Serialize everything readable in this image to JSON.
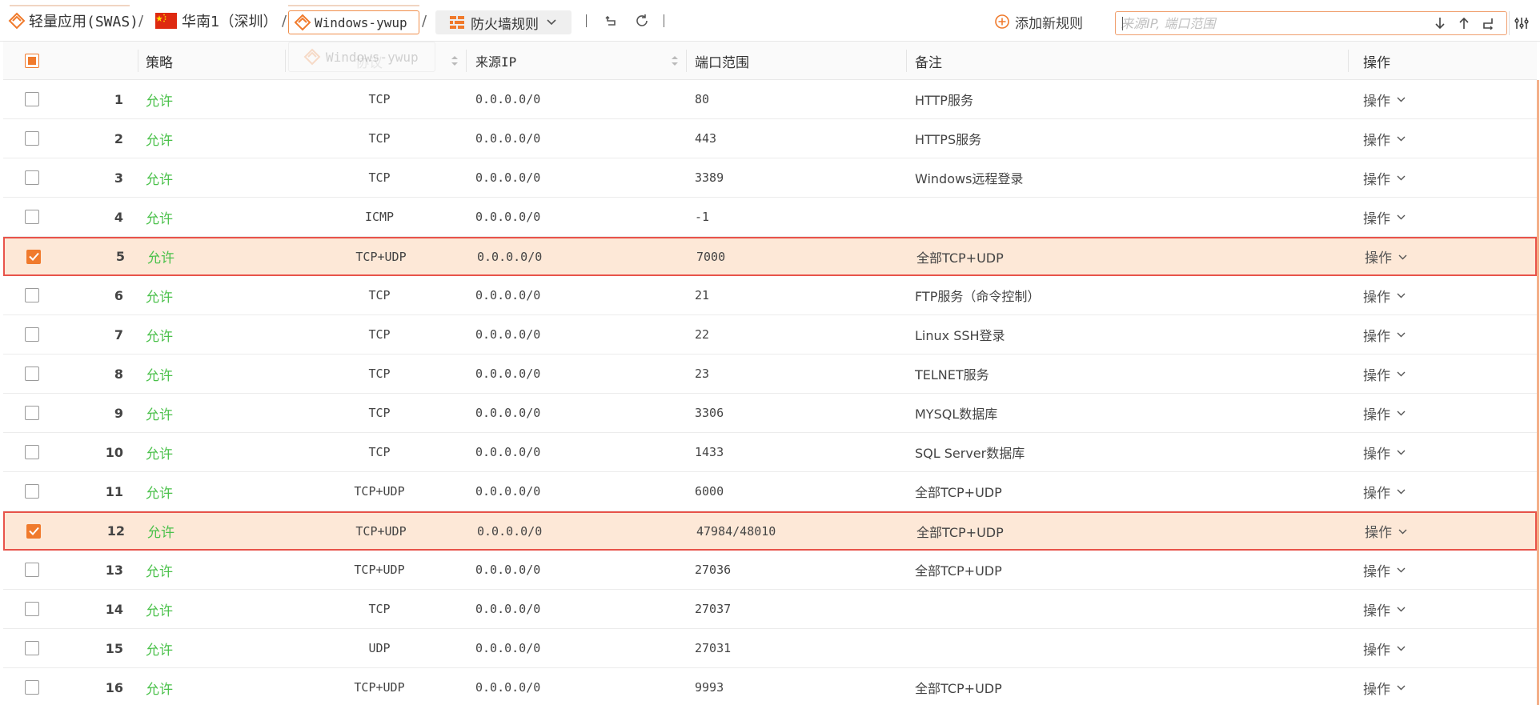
{
  "breadcrumb": {
    "swas_label": "轻量应用(SWAS)",
    "sep1": "/",
    "region_label": "华南1（深圳）",
    "sep2": "/",
    "instance_label": "Windows-ywup",
    "sep3": "/",
    "section_label": "防火墙规则"
  },
  "toolbar": {
    "add_rule_label": "添加新规则",
    "search_placeholder": "来源IP, 端口范围"
  },
  "drag_ghost_label": "Windows-ywup",
  "colors": {
    "accent": "#f07a2c",
    "allow": "#4bc14b",
    "selected_row_bg": "#fde8d7",
    "selected_row_border": "#e8534a"
  },
  "table": {
    "headers": {
      "policy": "策略",
      "protocol": "协议",
      "source_ip": "来源IP",
      "port_range": "端口范围",
      "remark": "备注",
      "action": "操作"
    },
    "rows": [
      {
        "index": "1",
        "policy": "允许",
        "protocol": "TCP",
        "source_ip": "0.0.0.0/0",
        "port_range": "80",
        "remark": "HTTP服务",
        "action": "操作",
        "selected": false
      },
      {
        "index": "2",
        "policy": "允许",
        "protocol": "TCP",
        "source_ip": "0.0.0.0/0",
        "port_range": "443",
        "remark": "HTTPS服务",
        "action": "操作",
        "selected": false
      },
      {
        "index": "3",
        "policy": "允许",
        "protocol": "TCP",
        "source_ip": "0.0.0.0/0",
        "port_range": "3389",
        "remark": "Windows远程登录",
        "action": "操作",
        "selected": false
      },
      {
        "index": "4",
        "policy": "允许",
        "protocol": "ICMP",
        "source_ip": "0.0.0.0/0",
        "port_range": "-1",
        "remark": "",
        "action": "操作",
        "selected": false
      },
      {
        "index": "5",
        "policy": "允许",
        "protocol": "TCP+UDP",
        "source_ip": "0.0.0.0/0",
        "port_range": "7000",
        "remark": "全部TCP+UDP",
        "action": "操作",
        "selected": true
      },
      {
        "index": "6",
        "policy": "允许",
        "protocol": "TCP",
        "source_ip": "0.0.0.0/0",
        "port_range": "21",
        "remark": "FTP服务（命令控制）",
        "action": "操作",
        "selected": false
      },
      {
        "index": "7",
        "policy": "允许",
        "protocol": "TCP",
        "source_ip": "0.0.0.0/0",
        "port_range": "22",
        "remark": "Linux SSH登录",
        "action": "操作",
        "selected": false
      },
      {
        "index": "8",
        "policy": "允许",
        "protocol": "TCP",
        "source_ip": "0.0.0.0/0",
        "port_range": "23",
        "remark": "TELNET服务",
        "action": "操作",
        "selected": false
      },
      {
        "index": "9",
        "policy": "允许",
        "protocol": "TCP",
        "source_ip": "0.0.0.0/0",
        "port_range": "3306",
        "remark": "MYSQL数据库",
        "action": "操作",
        "selected": false
      },
      {
        "index": "10",
        "policy": "允许",
        "protocol": "TCP",
        "source_ip": "0.0.0.0/0",
        "port_range": "1433",
        "remark": "SQL Server数据库",
        "action": "操作",
        "selected": false
      },
      {
        "index": "11",
        "policy": "允许",
        "protocol": "TCP+UDP",
        "source_ip": "0.0.0.0/0",
        "port_range": "6000",
        "remark": "全部TCP+UDP",
        "action": "操作",
        "selected": false
      },
      {
        "index": "12",
        "policy": "允许",
        "protocol": "TCP+UDP",
        "source_ip": "0.0.0.0/0",
        "port_range": "47984/48010",
        "remark": "全部TCP+UDP",
        "action": "操作",
        "selected": true
      },
      {
        "index": "13",
        "policy": "允许",
        "protocol": "TCP+UDP",
        "source_ip": "0.0.0.0/0",
        "port_range": "27036",
        "remark": "全部TCP+UDP",
        "action": "操作",
        "selected": false
      },
      {
        "index": "14",
        "policy": "允许",
        "protocol": "TCP",
        "source_ip": "0.0.0.0/0",
        "port_range": "27037",
        "remark": "",
        "action": "操作",
        "selected": false
      },
      {
        "index": "15",
        "policy": "允许",
        "protocol": "UDP",
        "source_ip": "0.0.0.0/0",
        "port_range": "27031",
        "remark": "",
        "action": "操作",
        "selected": false
      },
      {
        "index": "16",
        "policy": "允许",
        "protocol": "TCP+UDP",
        "source_ip": "0.0.0.0/0",
        "port_range": "9993",
        "remark": "全部TCP+UDP",
        "action": "操作",
        "selected": false
      }
    ]
  }
}
